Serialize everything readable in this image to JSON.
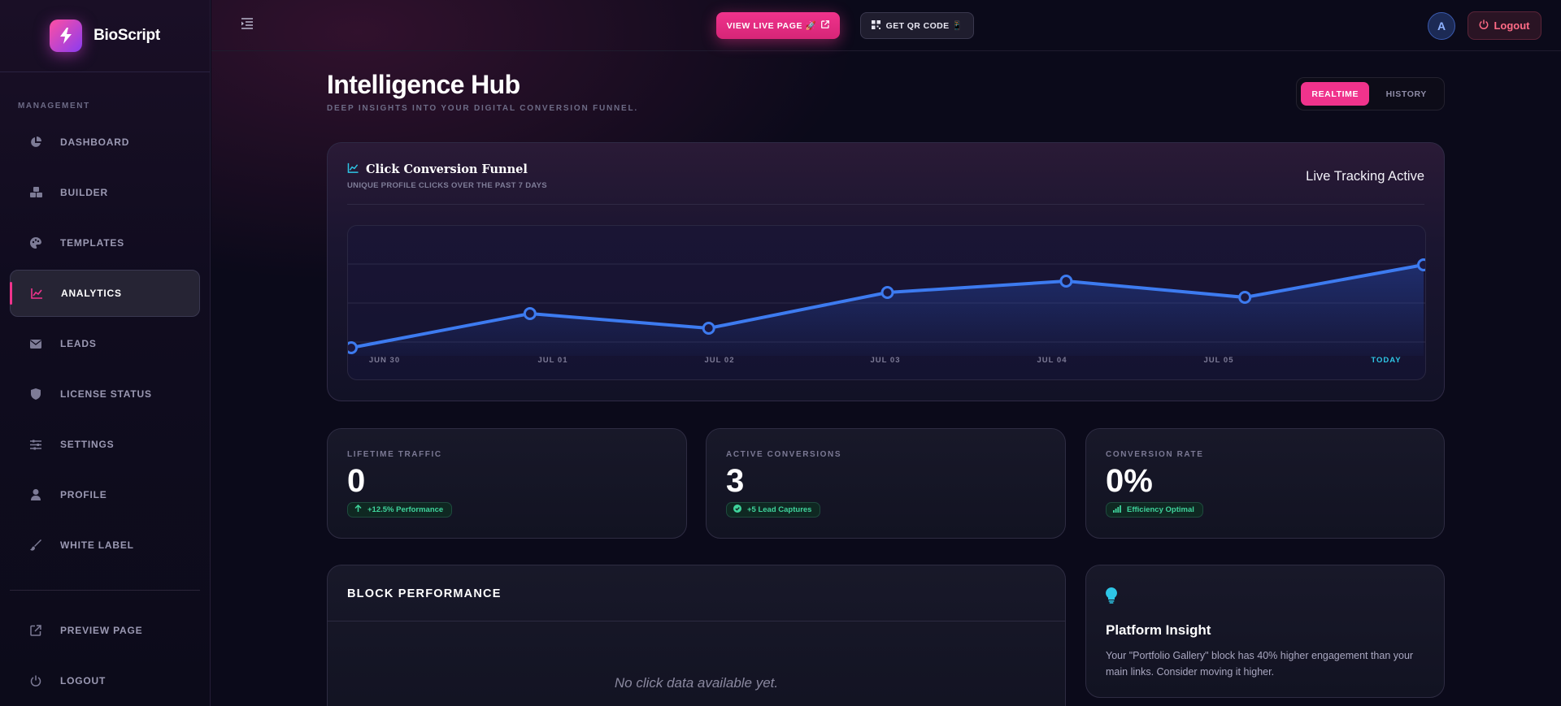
{
  "brand": {
    "name": "BioScript",
    "logo_icon": "bolt-icon"
  },
  "sidebar": {
    "section_label": "MANAGEMENT",
    "items": [
      {
        "label": "DASHBOARD",
        "icon": "pie-chart-icon",
        "active": false
      },
      {
        "label": "BUILDER",
        "icon": "cubes-icon",
        "active": false
      },
      {
        "label": "TEMPLATES",
        "icon": "palette-icon",
        "active": false
      },
      {
        "label": "ANALYTICS",
        "icon": "line-chart-icon",
        "active": true
      },
      {
        "label": "LEADS",
        "icon": "envelope-icon",
        "active": false
      },
      {
        "label": "LICENSE STATUS",
        "icon": "shield-icon",
        "active": false
      },
      {
        "label": "SETTINGS",
        "icon": "sliders-icon",
        "active": false
      },
      {
        "label": "PROFILE",
        "icon": "user-icon",
        "active": false
      },
      {
        "label": "WHITE LABEL",
        "icon": "brush-icon",
        "active": false
      }
    ],
    "bottom_items": [
      {
        "label": "PREVIEW PAGE",
        "icon": "external-link-icon"
      },
      {
        "label": "LOGOUT",
        "icon": "power-icon"
      }
    ]
  },
  "topbar": {
    "view_live_label": "VIEW LIVE PAGE 🚀",
    "qr_label": "GET QR CODE 📱",
    "avatar_initial": "A",
    "logout_label": "Logout"
  },
  "header": {
    "title": "Intelligence Hub",
    "subtitle": "DEEP INSIGHTS INTO YOUR DIGITAL CONVERSION FUNNEL.",
    "toggle": {
      "realtime": "REALTIME",
      "history": "HISTORY",
      "active": "realtime"
    }
  },
  "chart_card": {
    "title": "Click Conversion Funnel",
    "subtitle": "UNIQUE PROFILE CLICKS OVER THE PAST 7 DAYS",
    "status": "Live Tracking Active"
  },
  "chart_data": {
    "type": "area",
    "categories": [
      "JUN 30",
      "JUL 01",
      "JUL 02",
      "JUL 03",
      "JUL 04",
      "JUL 05",
      "TODAY"
    ],
    "values": [
      0.5,
      2.6,
      1.7,
      3.9,
      4.6,
      3.6,
      5.6
    ],
    "ylim": [
      0,
      8
    ],
    "grid": true,
    "line_color": "#3d7bf0",
    "highlight_color": "#2ec6e6"
  },
  "stats": [
    {
      "label": "LIFETIME TRAFFIC",
      "value": "0",
      "badge": "+12.5% Performance",
      "badge_icon": "arrow-up-icon"
    },
    {
      "label": "ACTIVE CONVERSIONS",
      "value": "3",
      "badge": "+5 Lead Captures",
      "badge_icon": "check-circle-icon"
    },
    {
      "label": "CONVERSION RATE",
      "value": "0%",
      "badge": "Efficiency Optimal",
      "badge_icon": "signal-icon"
    }
  ],
  "block_performance": {
    "title": "BLOCK PERFORMANCE",
    "empty_text": "No click data available yet."
  },
  "insight": {
    "title": "Platform Insight",
    "text": "Your \"Portfolio Gallery\" block has 40% higher engagement than your main links. Consider moving it higher.",
    "icon": "lightbulb-icon"
  },
  "colors": {
    "accent": "#f0338c",
    "chart_line": "#3d7bf0",
    "success": "#3fd49c",
    "danger": "#ff6b86"
  }
}
